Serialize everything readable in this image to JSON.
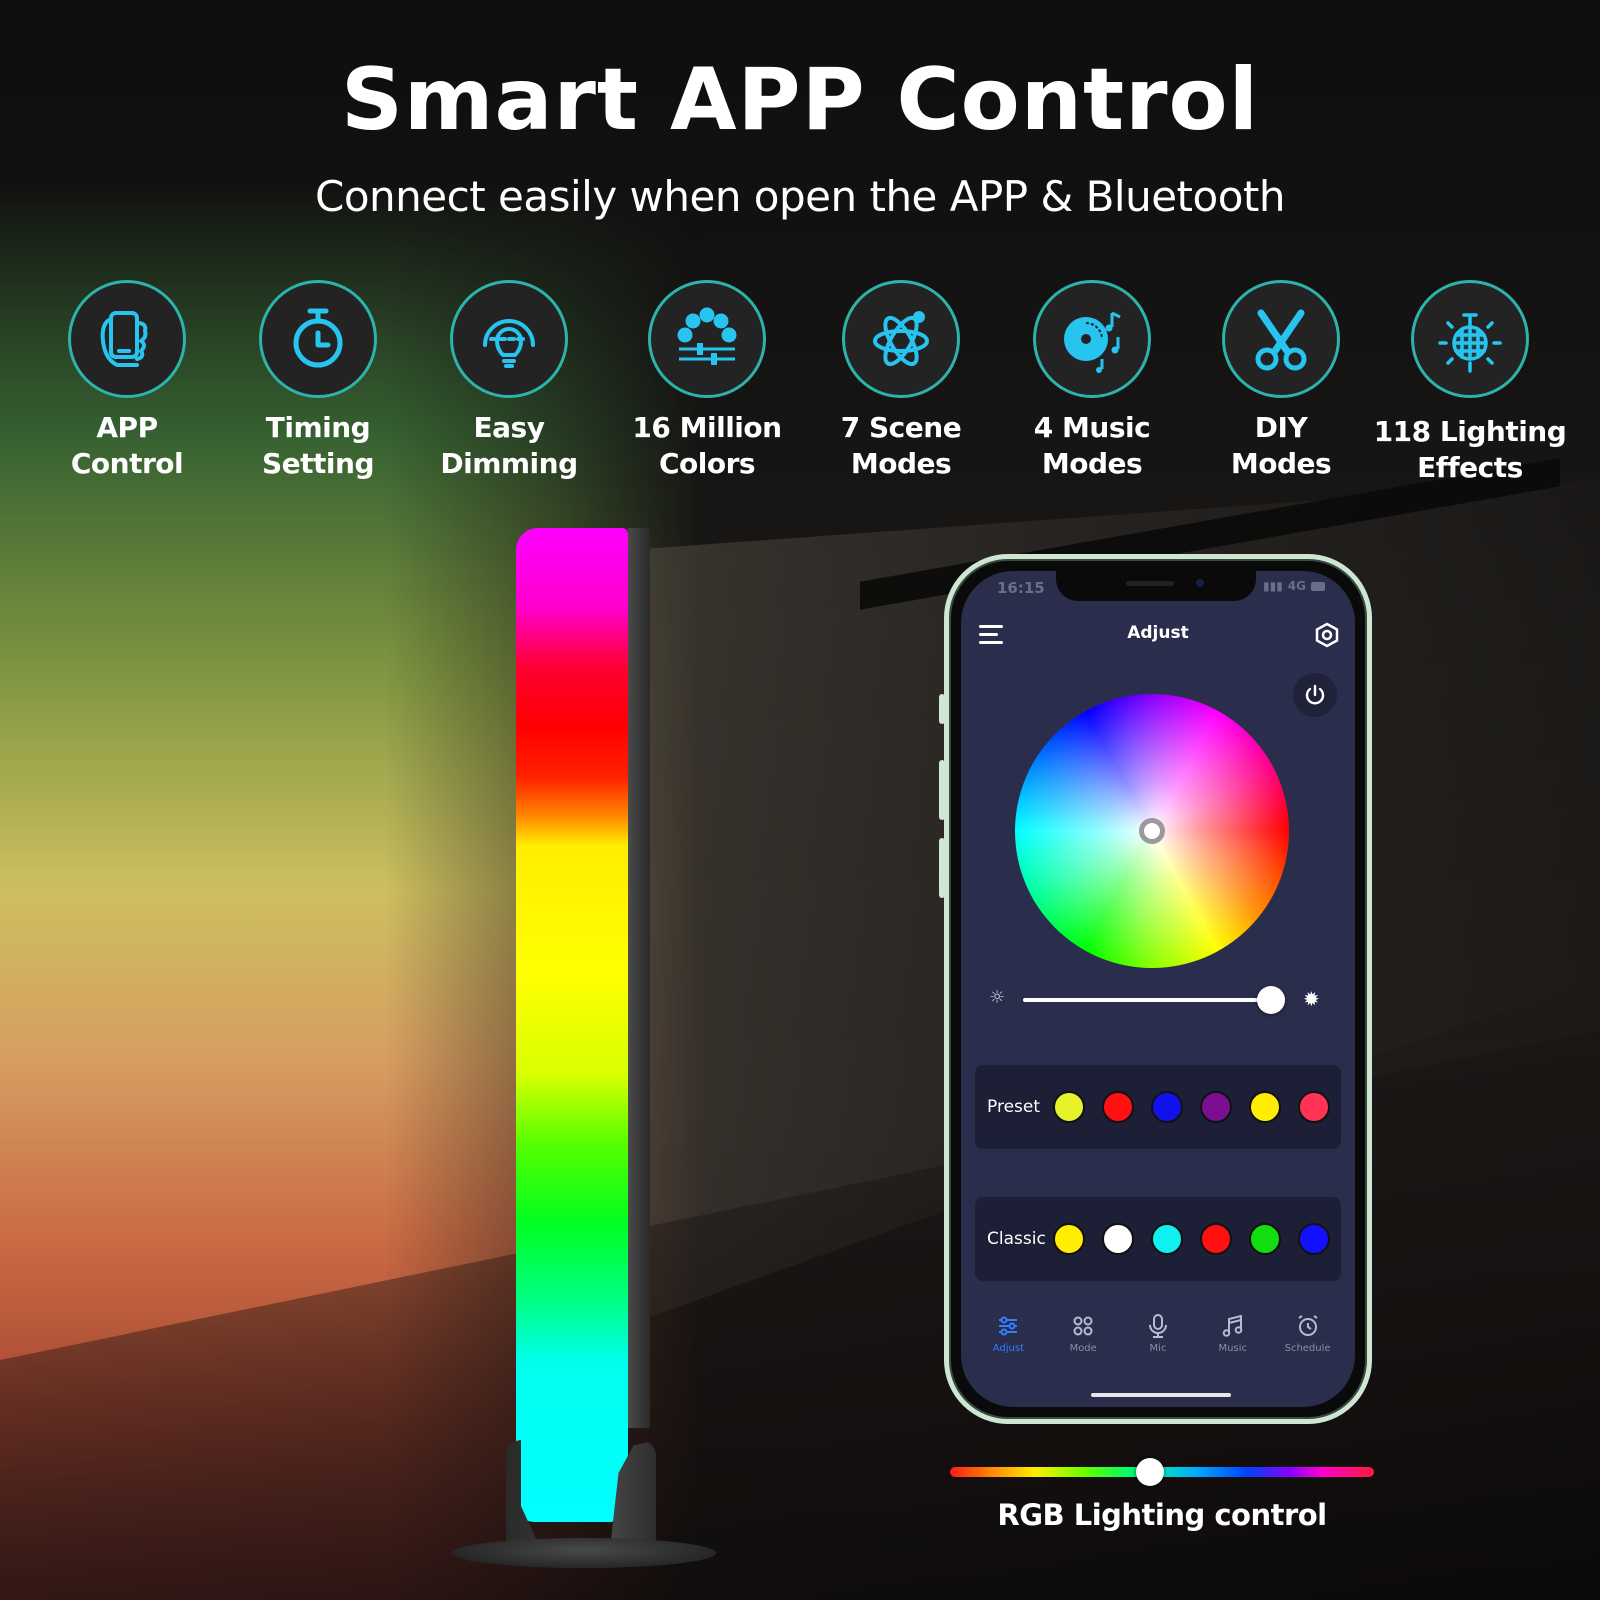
{
  "header": {
    "title": "Smart APP Control",
    "subtitle": "Connect easily when open the APP & Bluetooth"
  },
  "features": [
    {
      "icon": "phone-in-hand-icon",
      "line1": "APP",
      "line2": "Control"
    },
    {
      "icon": "stopwatch-icon",
      "line1": "Timing",
      "line2": "Setting"
    },
    {
      "icon": "dimming-bulb-icon",
      "line1": "Easy",
      "line2": "Dimming"
    },
    {
      "icon": "color-dots-sliders-icon",
      "line1": "16 Million",
      "line2": "Colors"
    },
    {
      "icon": "atom-icon",
      "line1": "7 Scene",
      "line2": "Modes"
    },
    {
      "icon": "music-disc-icon",
      "line1": "4 Music",
      "line2": "Modes"
    },
    {
      "icon": "scissors-icon",
      "line1": "DIY",
      "line2": "Modes"
    },
    {
      "icon": "disco-ball-icon",
      "line1": "118 Lighting",
      "line2": "Effects"
    }
  ],
  "colors": {
    "accent_ring": "#2cb3aa",
    "icon_cyan": "#27c4ef",
    "app_bg": "#2a2d4b",
    "app_panel": "#1c1f36",
    "tab_active": "#2f7fff"
  },
  "phone": {
    "status": {
      "time": "16:15",
      "network": "4G"
    },
    "appbar": {
      "title": "Adjust"
    },
    "brightness_percent": 100,
    "preset": {
      "label": "Preset",
      "swatches": [
        "#e6f22c",
        "#ff1111",
        "#1111ee",
        "#7a0f8f",
        "#ffee00",
        "#ff3355"
      ]
    },
    "classic": {
      "label": "Classic",
      "swatches": [
        "#ffee00",
        "#ffffff",
        "#11f0f0",
        "#ff1111",
        "#11dd11",
        "#1111ff"
      ]
    },
    "tabs": [
      {
        "icon": "sliders-icon",
        "label": "Adjust",
        "active": true
      },
      {
        "icon": "grid-icon",
        "label": "Mode",
        "active": false
      },
      {
        "icon": "microphone-icon",
        "label": "Mic",
        "active": false
      },
      {
        "icon": "music-note-icon",
        "label": "Music",
        "active": false
      },
      {
        "icon": "alarm-clock-icon",
        "label": "Schedule",
        "active": false
      }
    ]
  },
  "rgb_control": {
    "label": "RGB Lighting control",
    "hue_position_percent": 50
  }
}
